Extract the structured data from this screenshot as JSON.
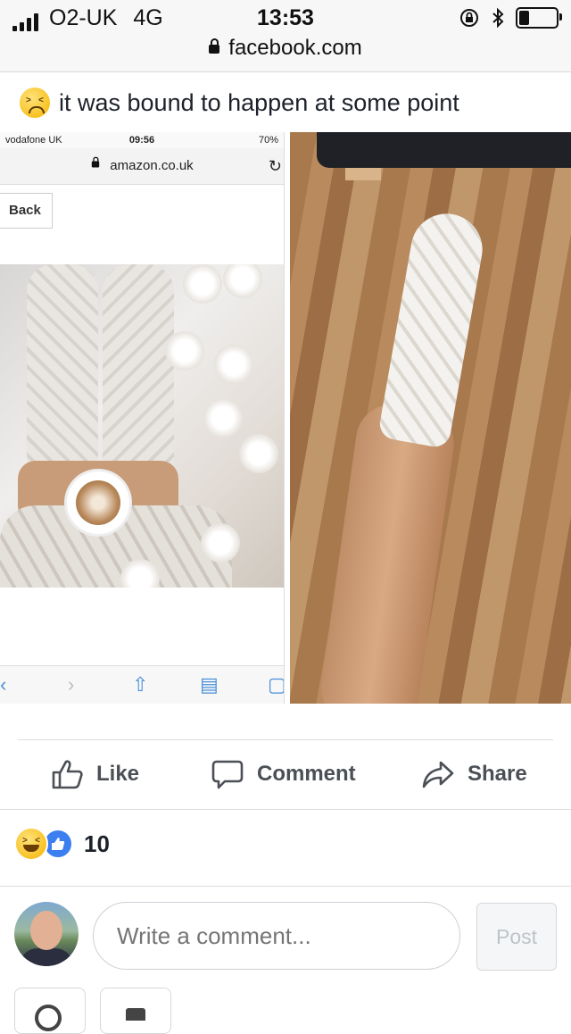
{
  "status_bar": {
    "carrier": "O2-UK",
    "network": "4G",
    "time": "13:53",
    "url": "facebook.com"
  },
  "post": {
    "text": "it was bound to happen at some point",
    "emoji_icon": "tired-face-emoji-icon"
  },
  "left_photo": {
    "carrier": "vodafone UK",
    "time": "09:56",
    "battery": "70%",
    "url": "amazon.co.uk",
    "back_label": "Back"
  },
  "actions": {
    "like_label": "Like",
    "comment_label": "Comment",
    "share_label": "Share"
  },
  "reactions": {
    "count": "10",
    "icons": [
      "haha-reaction-icon",
      "like-reaction-icon"
    ]
  },
  "composer": {
    "placeholder": "Write a comment...",
    "post_label": "Post"
  },
  "colors": {
    "like_blue": "#3b7ff0",
    "action_gray": "#4b4f56",
    "placeholder_gray": "#90949c"
  }
}
